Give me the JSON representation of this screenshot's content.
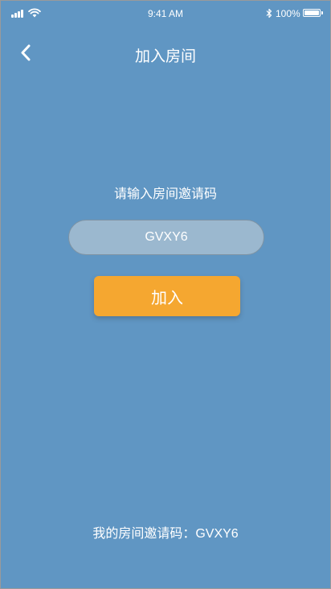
{
  "status_bar": {
    "time": "9:41 AM",
    "battery_percent": "100%",
    "battery_level": 1.0,
    "signal_bars": 4,
    "icons": [
      "signal-icon",
      "wifi-icon",
      "bluetooth-icon",
      "battery-icon"
    ]
  },
  "nav": {
    "back_icon": "chevron-left-icon",
    "title": "加入房间"
  },
  "form": {
    "prompt": "请输入房间邀请码",
    "code_value": "GVXY6",
    "join_label": "加入"
  },
  "footer": {
    "my_code_label": "我的房间邀请码：",
    "my_code_value": "GVXY6"
  },
  "colors": {
    "background": "#6096c3",
    "input_fill": "#9bb8cf",
    "accent": "#f5a730",
    "text": "#ffffff"
  }
}
